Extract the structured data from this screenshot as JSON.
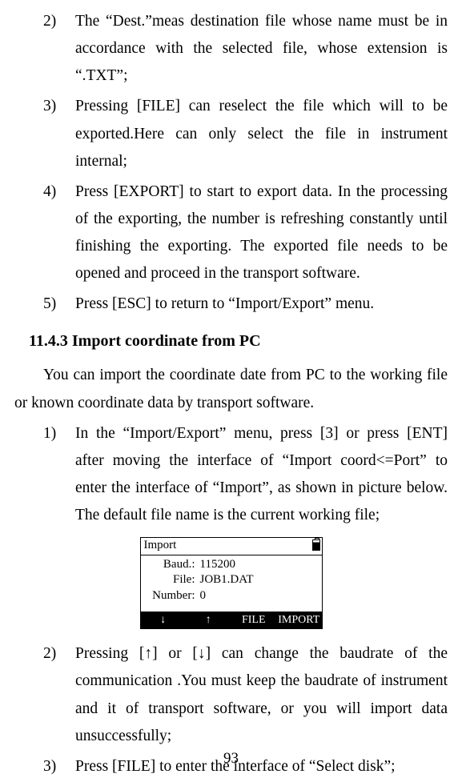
{
  "listA": [
    {
      "marker": "2)",
      "text": "The “Dest.”meas destination file whose name must be in accordance with the selected file, whose extension is “.TXT”;"
    },
    {
      "marker": "3)",
      "text": "Pressing [FILE] can reselect the file which will to be exported.Here can only select the file in instrument internal;"
    },
    {
      "marker": "4)",
      "text": "Press [EXPORT] to start to export data. In the processing of the exporting, the number is refreshing constantly until finishing the exporting. The exported file needs to be opened and proceed in the transport software."
    },
    {
      "marker": "5)",
      "text": "Press [ESC] to return to “Import/Export” menu."
    }
  ],
  "heading": "11.4.3 Import coordinate from PC",
  "intro": "You can import the coordinate date from PC to the working file or known coordinate data by transport software.",
  "listB": [
    {
      "marker": "1)",
      "text": "In the “Import/Export” menu, press [3] or press [ENT] after moving the interface of “Import coord<=Port” to enter the interface of “Import”, as shown in picture below. The default file name is the current working file;"
    }
  ],
  "screen": {
    "title": "Import",
    "rows": [
      {
        "label": "Baud.:",
        "value": "115200"
      },
      {
        "label": "File:",
        "value": "JOB1.DAT"
      },
      {
        "label": "Number:",
        "value": "0"
      }
    ],
    "softkeys": [
      {
        "label": "↓",
        "cls": "sk-dark"
      },
      {
        "label": "↑",
        "cls": "sk-dark"
      },
      {
        "label": "FILE",
        "cls": "sk-dark"
      },
      {
        "label": "IMPORT",
        "cls": "sk-dark"
      }
    ]
  },
  "listC": [
    {
      "marker": "2)",
      "text": "Pressing [↑] or [↓] can change the  baudrate of the communication .You must keep the baudrate of instrument and it of transport software, or you will import data unsuccessfully;"
    },
    {
      "marker": "3)",
      "text": "Press [FILE] to enter the interface of “Select disk”;"
    }
  ],
  "pageNumber": "93"
}
